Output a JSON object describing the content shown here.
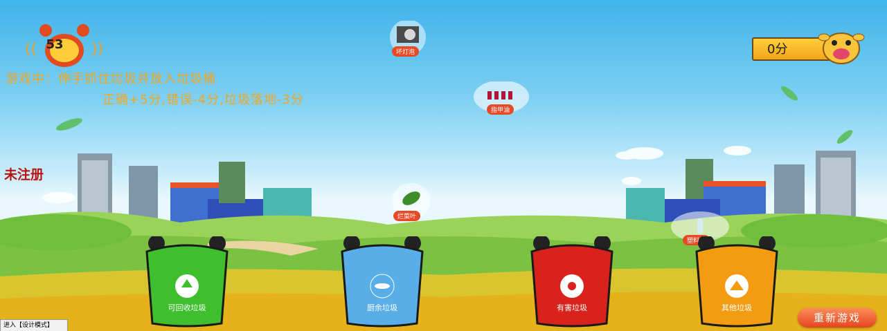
{
  "timer": {
    "value": "53",
    "icon": "alarm-clock-icon"
  },
  "instructions": {
    "line1": "游戏中：伸手抓住垃圾并放入垃圾桶",
    "line2": "正确+5分,错误-4分,垃圾落地-3分"
  },
  "status": {
    "unregistered": "未注册"
  },
  "score": {
    "text": "0分",
    "mascot": "cow-mascot-icon"
  },
  "items": [
    {
      "label": "坏灯泡",
      "icon": "broken-bulb-icon"
    },
    {
      "label": "指甲油",
      "icon": "nail-polish-icon"
    },
    {
      "label": "烂菜叶",
      "icon": "rotten-leaf-icon"
    },
    {
      "label": "塑料瓶",
      "icon": "plastic-bottle-icon"
    }
  ],
  "bins": [
    {
      "label": "可回收垃圾",
      "color": "#3fbf2e",
      "icon": "recycle-icon"
    },
    {
      "label": "厨余垃圾",
      "color": "#5aaee8",
      "icon": "fish-icon"
    },
    {
      "label": "有害垃圾",
      "color": "#d9221b",
      "icon": "radiation-icon"
    },
    {
      "label": "其他垃圾",
      "color": "#f39c12",
      "icon": "tree-icon"
    }
  ],
  "controls": {
    "restart": "重新游戏",
    "design_mode": "进入【设计模式】"
  }
}
